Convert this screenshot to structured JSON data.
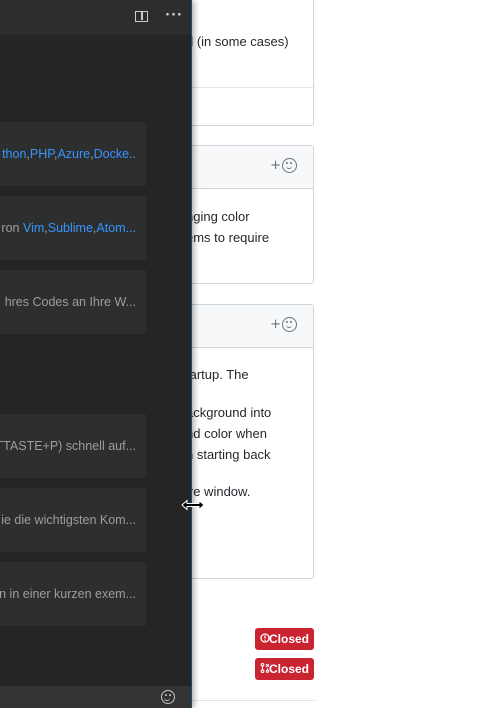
{
  "github": {
    "card1_text": [
      "d (in some cases)"
    ],
    "card2_text": [
      "nging color",
      "ems to require"
    ],
    "card3_text": [
      "tartup. The",
      "",
      "ackground into",
      "nd color when",
      "n starting back",
      "",
      "ire window."
    ],
    "badges": [
      {
        "label": "Closed",
        "icon": "issue-closed-icon",
        "color": "#cb2431"
      },
      {
        "label": "Closed",
        "icon": "pr-closed-icon",
        "color": "#cb2431"
      }
    ]
  },
  "editor": {
    "walkthroughs": [
      {
        "prefix": "",
        "links": [
          "thon",
          "PHP",
          "Azure",
          "Docke.."
        ],
        "suffix": ""
      },
      {
        "prefix": "ron ",
        "links": [
          "Vim",
          "Sublime",
          "Atom..."
        ],
        "suffix": ""
      },
      {
        "prefix": "",
        "links": [],
        "suffix": "hres Codes an Ihre W..."
      },
      {
        "prefix": "",
        "links": [],
        "suffix": "TTASTE+P) schnell auf..."
      },
      {
        "prefix": "",
        "links": [],
        "suffix": "ie die wichtigsten Kom..."
      },
      {
        "prefix": "",
        "links": [],
        "suffix": "n in einer kurzen exem..."
      }
    ]
  }
}
